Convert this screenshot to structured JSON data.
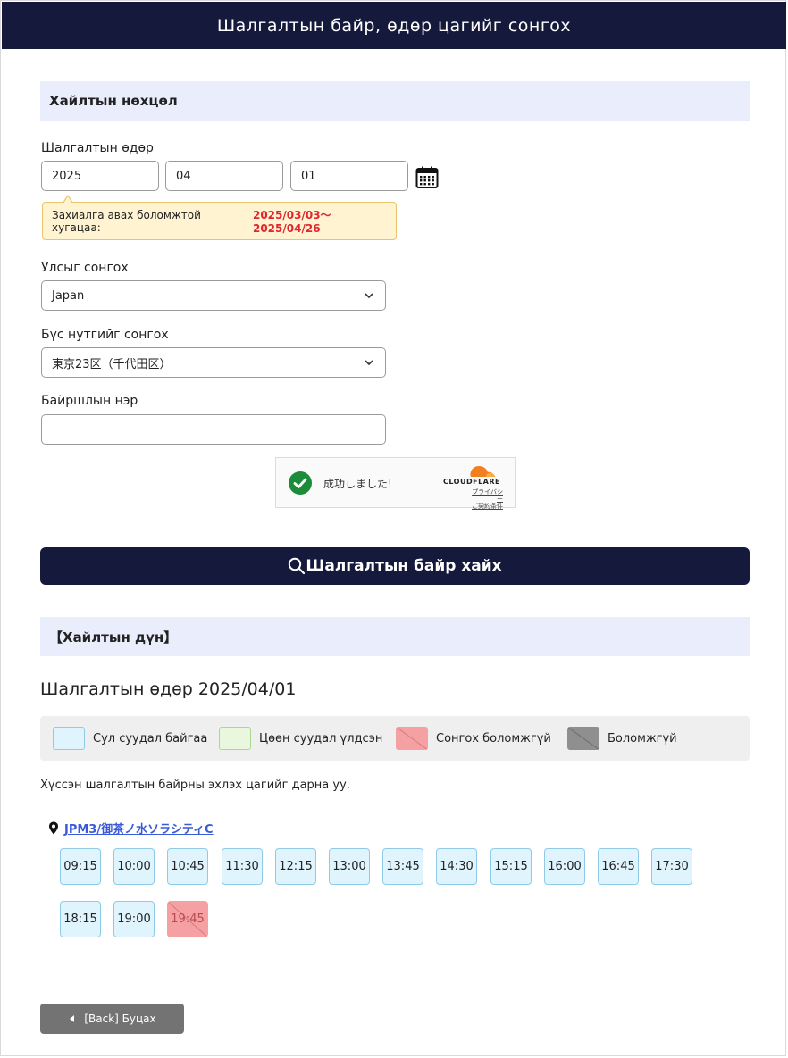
{
  "header": {
    "title": "Шалгалтын байр, өдөр цагийг сонгох"
  },
  "search_section": {
    "title": "Хайлтын нөхцөл",
    "date_label": "Шалгалтын өдөр",
    "year": "2025",
    "month": "04",
    "day": "01",
    "tooltip_text": "Захиалга авах боломжтой хугацаа: ",
    "tooltip_range": "2025/03/03～2025/04/26",
    "country_label": "Улсыг сонгох",
    "country_value": "Japan",
    "region_label": "Бүс нутгийг сонгох",
    "region_value": "東京23区（千代田区）",
    "venue_label": "Байршлын нэр",
    "venue_value": "",
    "search_button": "Шалгалтын байр хайх"
  },
  "captcha": {
    "status": "成功しました!",
    "brand": "CLOUDFLARE",
    "privacy": "プライバシー",
    "terms": "ご契約条件"
  },
  "results": {
    "title": "【Хайлтын дүн】",
    "date_line": "Шалгалтын өдөр 2025/04/01",
    "legend": [
      {
        "label": "Сул суудал байгаа",
        "color": "#dff4fd"
      },
      {
        "label": "Цөөн суудал үлдсэн",
        "color": "#e8f7dd"
      },
      {
        "label": "Сонгох боломжгүй",
        "color": "#f5a0a2"
      },
      {
        "label": "Боломжгүй",
        "color": "#8f8f8f"
      }
    ],
    "instruction": "Хүссэн шалгалтын байрны эхлэх цагийг дарна уу.",
    "location_name": "JPM3/御茶ノ水ソラシティC",
    "slots": [
      {
        "time": "09:15",
        "status": "available"
      },
      {
        "time": "10:00",
        "status": "available"
      },
      {
        "time": "10:45",
        "status": "available"
      },
      {
        "time": "11:30",
        "status": "available"
      },
      {
        "time": "12:15",
        "status": "available"
      },
      {
        "time": "13:00",
        "status": "available"
      },
      {
        "time": "13:45",
        "status": "available"
      },
      {
        "time": "14:30",
        "status": "available"
      },
      {
        "time": "15:15",
        "status": "available"
      },
      {
        "time": "16:00",
        "status": "available"
      },
      {
        "time": "16:45",
        "status": "available"
      },
      {
        "time": "17:30",
        "status": "available"
      },
      {
        "time": "18:15",
        "status": "available"
      },
      {
        "time": "19:00",
        "status": "available"
      },
      {
        "time": "19:45",
        "status": "unselectable"
      }
    ]
  },
  "back_button": "[Back] Буцах"
}
